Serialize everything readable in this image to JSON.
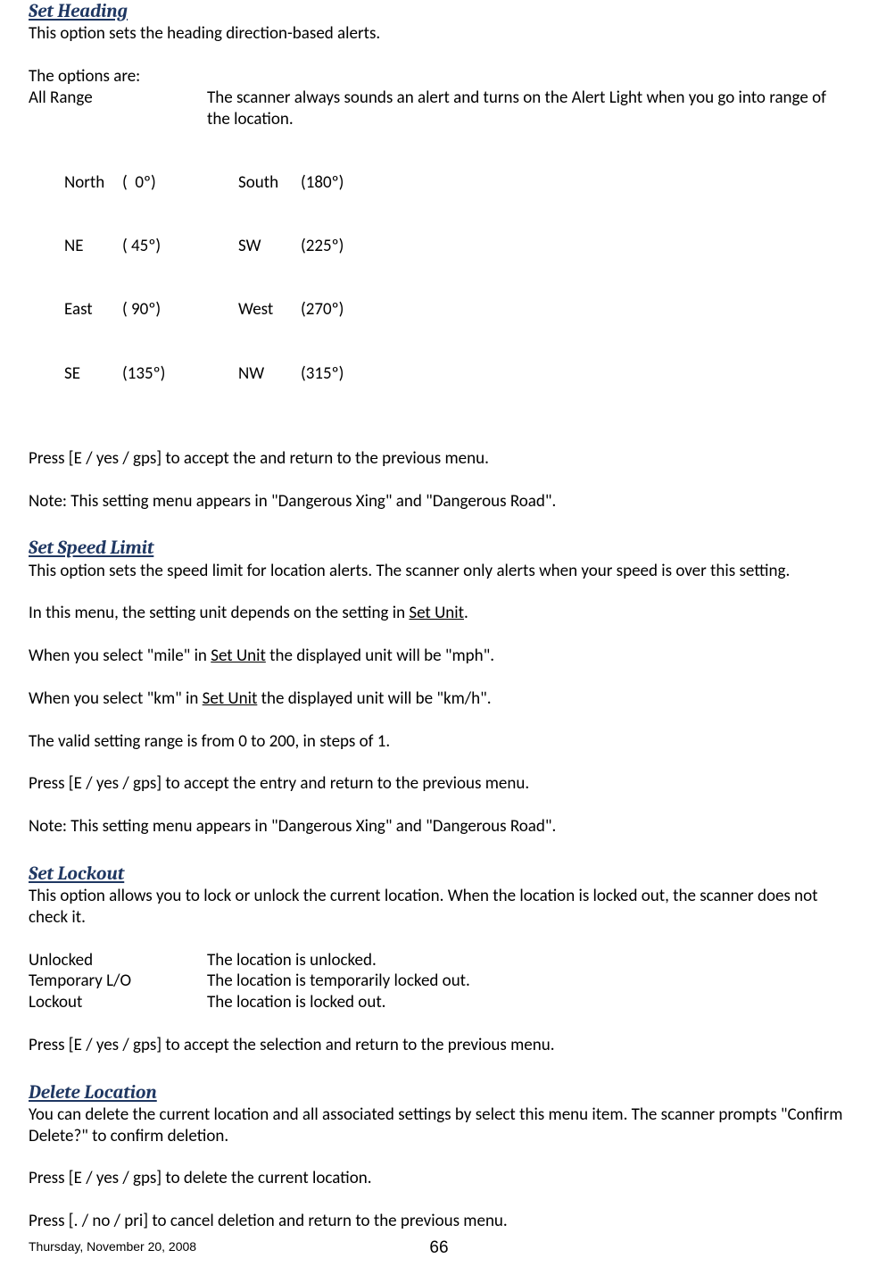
{
  "setHeading": {
    "title": "Set Heading",
    "intro": "This option sets the heading direction-based alerts.",
    "optionsAre": "The options are:",
    "allRangeLabel": "All Range",
    "allRangeDesc": "The scanner always sounds an alert and turns on the Alert Light when you go into range of the location.",
    "dirs": {
      "r1c1": "North",
      "r1c2": "(  0º)",
      "r1c3": "South",
      "r1c4": "(180º)",
      "r2c1": "NE",
      "r2c2": "( 45º)",
      "r2c3": "SW",
      "r2c4": "(225º)",
      "r3c1": "East",
      "r3c2": "( 90º)",
      "r3c3": "West",
      "r3c4": "(270º)",
      "r4c1": "SE",
      "r4c2": "(135º)",
      "r4c3": "NW",
      "r4c4": "(315º)"
    },
    "press": "Press [E / yes / gps] to accept the and return to the previous menu.",
    "note": "Note: This setting menu appears in \"Dangerous Xing\" and \"Dangerous Road\"."
  },
  "setSpeedLimit": {
    "title": "Set Speed Limit",
    "intro": "This option sets the speed limit for location alerts. The scanner only alerts when your speed is over this setting.",
    "dependsPre": "In this menu, the setting unit depends on the setting in ",
    "setUnit": "Set Unit",
    "dependsPost": ".",
    "milePre": "When you select \"mile\" in ",
    "milePost": " the displayed unit will be \"mph\".",
    "kmPre": "When you select \"km\" in ",
    "kmPost": " the displayed unit will be \"km/h\".",
    "range": "The valid setting range is from 0 to 200, in steps of 1.",
    "press": "Press [E / yes / gps] to accept the entry and return to the previous menu.",
    "note": "Note: This setting menu appears in \"Dangerous Xing\" and \"Dangerous Road\"."
  },
  "setLockout": {
    "title": "Set Lockout",
    "intro": "This option allows you to lock or unlock the current location. When the location is locked out, the scanner does not check it.",
    "rows": {
      "unlockedLabel": "Unlocked",
      "unlockedDesc": "The location is unlocked.",
      "tempLabel": "Temporary L/O",
      "tempDesc": "The location is temporarily locked out.",
      "lockLabel": "Lockout",
      "lockDesc": "The location is locked out."
    },
    "press": "Press [E / yes / gps] to accept the selection and return to the previous menu."
  },
  "deleteLocation": {
    "title": "Delete Location",
    "intro": "You can delete the current location and all associated settings by select this menu item. The scanner prompts \"Confirm Delete?\" to confirm deletion.",
    "pressYes": "Press [E / yes / gps] to delete the current location.",
    "pressNo": "Press [. / no / pri] to cancel deletion and return to the previous menu."
  },
  "footer": {
    "date": "Thursday, November 20, 2008",
    "page": "66"
  }
}
